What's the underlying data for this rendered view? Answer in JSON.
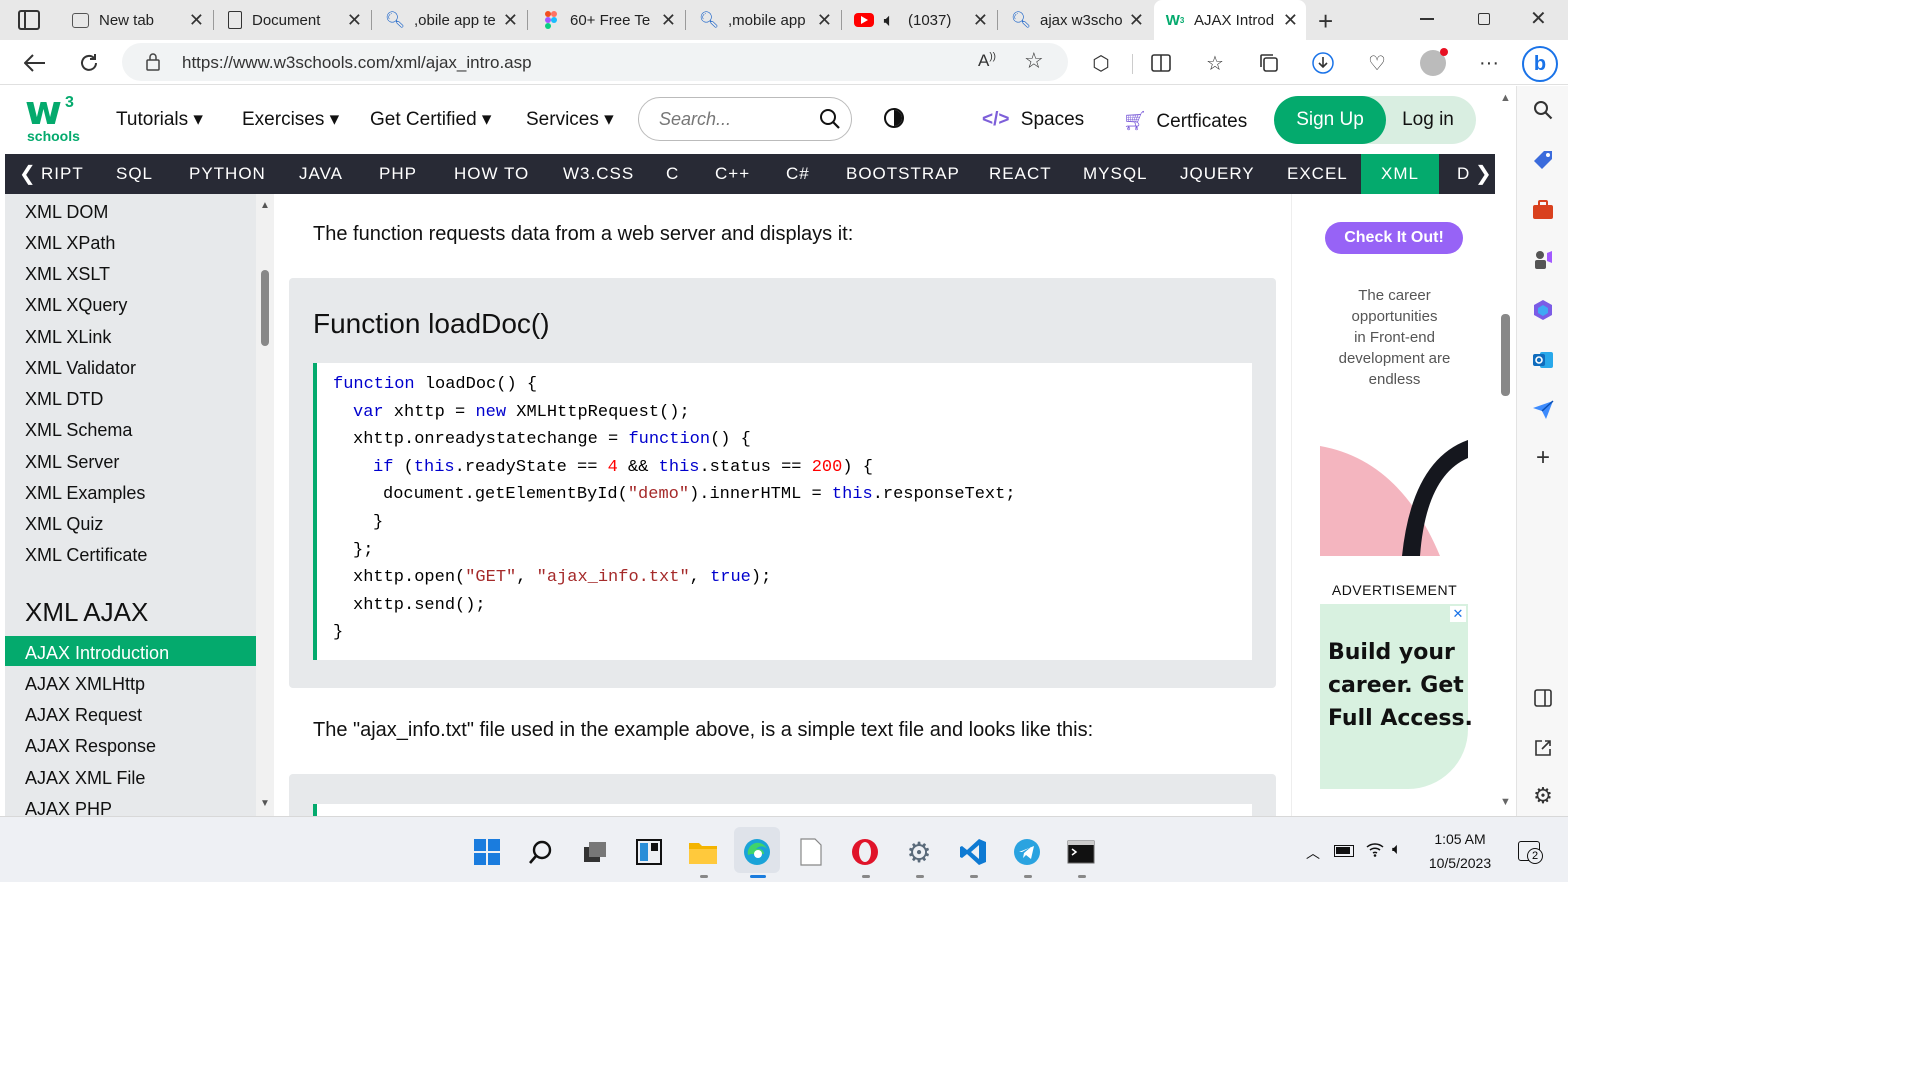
{
  "browser": {
    "tabs": [
      {
        "label": "New tab",
        "icon": "new-tab-icon"
      },
      {
        "label": "Document",
        "icon": "document-icon"
      },
      {
        "label": ",obile app te",
        "icon": "search-icon"
      },
      {
        "label": "60+ Free Te",
        "icon": "figma-icon"
      },
      {
        "label": ",mobile app",
        "icon": "search-icon"
      },
      {
        "label": "(1037)",
        "icon": "youtube-icon"
      },
      {
        "label": "ajax w3scho",
        "icon": "search-icon"
      },
      {
        "label": "AJAX Introd",
        "icon": "w3schools-icon"
      }
    ],
    "url": "https://www.w3schools.com/xml/ajax_intro.asp"
  },
  "w3": {
    "logo_main": "w",
    "logo_sup": "3",
    "logo_sub": "schools",
    "nav": [
      "Tutorials",
      "Exercises",
      "Get Certified",
      "Services"
    ],
    "search_placeholder": "Search...",
    "spaces": "Spaces",
    "certificates": "Certficates",
    "signup": "Sign Up",
    "login": "Log in"
  },
  "topics": [
    "RIPT",
    "SQL",
    "PYTHON",
    "JAVA",
    "PHP",
    "HOW TO",
    "W3.CSS",
    "C",
    "C++",
    "C#",
    "BOOTSTRAP",
    "REACT",
    "MYSQL",
    "JQUERY",
    "EXCEL",
    "XML",
    "D"
  ],
  "sidebar": {
    "items_top": [
      "XML DOM",
      "XML XPath",
      "XML XSLT",
      "XML XQuery",
      "XML XLink",
      "XML Validator",
      "XML DTD",
      "XML Schema",
      "XML Server",
      "XML Examples",
      "XML Quiz",
      "XML Certificate"
    ],
    "heading": "XML AJAX",
    "active": "AJAX Introduction",
    "items_bottom": [
      "AJAX XMLHttp",
      "AJAX Request",
      "AJAX Response",
      "AJAX XML File",
      "AJAX PHP"
    ]
  },
  "main": {
    "intro": "The function requests data from a web server and displays it:",
    "example_title": "Function loadDoc()",
    "after": "The \"ajax_info.txt\" file used in the example above, is a simple text file and looks like this:"
  },
  "code": {
    "l1_kw": "function",
    "l1_rest": " loadDoc() {",
    "l2_kw1": "var",
    "l2_mid": " xhttp = ",
    "l2_kw2": "new",
    "l2_rest": " XMLHttpRequest();",
    "l3_pre": "xhttp.onreadystatechange = ",
    "l3_kw": "function",
    "l3_rest": "() {",
    "l4_kw1": "if",
    "l4_a": " (",
    "l4_kw2": "this",
    "l4_b": ".readyState == ",
    "l4_n1": "4",
    "l4_c": " && ",
    "l4_kw3": "this",
    "l4_d": ".status == ",
    "l4_n2": "200",
    "l4_e": ") {",
    "l5_pre": "document.getElementById(",
    "l5_str": "\"demo\"",
    "l5_mid": ").innerHTML = ",
    "l5_kw": "this",
    "l5_rest": ".responseText;",
    "l6": "}",
    "l7": "};",
    "l8_pre": "xhttp.open(",
    "l8_s1": "\"GET\"",
    "l8_c": ", ",
    "l8_s2": "\"ajax_info.txt\"",
    "l8_d": ", ",
    "l8_kw": "true",
    "l8_e": ");",
    "l9": "xhttp.send();",
    "l10": "}"
  },
  "ad": {
    "button": "Check It Out!",
    "lines": [
      "The career",
      "opportunities",
      "in Front-end",
      "development are",
      "endless"
    ],
    "label": "ADVERTISEMENT",
    "big": [
      "Build your",
      "career. Get",
      "Full Access."
    ],
    "close": "✕"
  },
  "taskbar": {
    "time": "1:05 AM",
    "date": "10/5/2023",
    "notif_count": "2"
  },
  "colors": {
    "w3_green": "#04aa6d",
    "topic_bar": "#282a35",
    "ad_purple": "#9763f6"
  }
}
